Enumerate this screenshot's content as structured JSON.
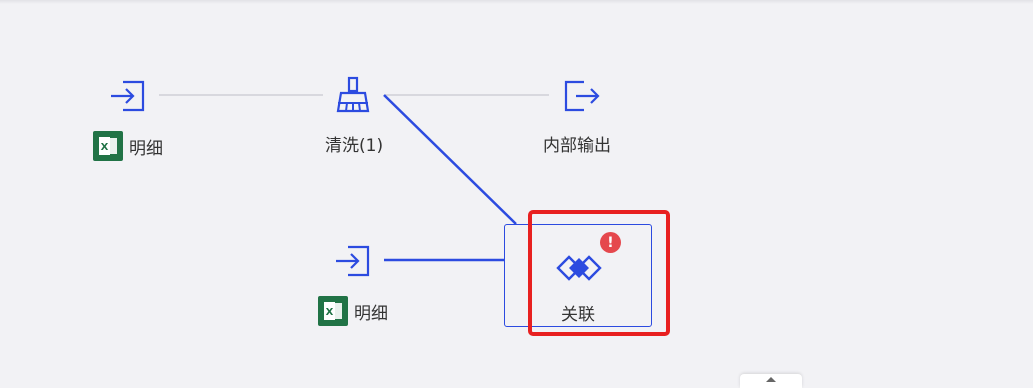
{
  "nodes": {
    "input_1": {
      "icon": "input-icon",
      "table_name": "明细",
      "table_icon": "excel-icon"
    },
    "clean": {
      "icon": "broom-icon",
      "label": "清洗(1)"
    },
    "output": {
      "icon": "output-icon",
      "label": "内部输出"
    },
    "input_2": {
      "icon": "input-icon",
      "table_name": "明细",
      "table_icon": "excel-icon"
    },
    "join": {
      "icon": "join-icon",
      "label": "关联",
      "status": "error",
      "error_mark": "!"
    }
  },
  "colors": {
    "accent": "#2c4be0",
    "edge_inactive": "#cfd0d6",
    "error": "#e5484d",
    "highlight": "#e82020",
    "excel": "#217346"
  }
}
